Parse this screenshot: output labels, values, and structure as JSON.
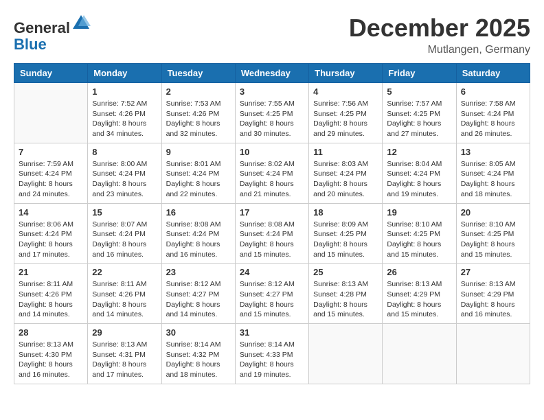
{
  "header": {
    "logo_general": "General",
    "logo_blue": "Blue",
    "month": "December 2025",
    "location": "Mutlangen, Germany"
  },
  "columns": [
    "Sunday",
    "Monday",
    "Tuesday",
    "Wednesday",
    "Thursday",
    "Friday",
    "Saturday"
  ],
  "weeks": [
    [
      {
        "day": "",
        "sunrise": "",
        "sunset": "",
        "daylight": ""
      },
      {
        "day": "1",
        "sunrise": "Sunrise: 7:52 AM",
        "sunset": "Sunset: 4:26 PM",
        "daylight": "Daylight: 8 hours and 34 minutes."
      },
      {
        "day": "2",
        "sunrise": "Sunrise: 7:53 AM",
        "sunset": "Sunset: 4:26 PM",
        "daylight": "Daylight: 8 hours and 32 minutes."
      },
      {
        "day": "3",
        "sunrise": "Sunrise: 7:55 AM",
        "sunset": "Sunset: 4:25 PM",
        "daylight": "Daylight: 8 hours and 30 minutes."
      },
      {
        "day": "4",
        "sunrise": "Sunrise: 7:56 AM",
        "sunset": "Sunset: 4:25 PM",
        "daylight": "Daylight: 8 hours and 29 minutes."
      },
      {
        "day": "5",
        "sunrise": "Sunrise: 7:57 AM",
        "sunset": "Sunset: 4:25 PM",
        "daylight": "Daylight: 8 hours and 27 minutes."
      },
      {
        "day": "6",
        "sunrise": "Sunrise: 7:58 AM",
        "sunset": "Sunset: 4:24 PM",
        "daylight": "Daylight: 8 hours and 26 minutes."
      }
    ],
    [
      {
        "day": "7",
        "sunrise": "Sunrise: 7:59 AM",
        "sunset": "Sunset: 4:24 PM",
        "daylight": "Daylight: 8 hours and 24 minutes."
      },
      {
        "day": "8",
        "sunrise": "Sunrise: 8:00 AM",
        "sunset": "Sunset: 4:24 PM",
        "daylight": "Daylight: 8 hours and 23 minutes."
      },
      {
        "day": "9",
        "sunrise": "Sunrise: 8:01 AM",
        "sunset": "Sunset: 4:24 PM",
        "daylight": "Daylight: 8 hours and 22 minutes."
      },
      {
        "day": "10",
        "sunrise": "Sunrise: 8:02 AM",
        "sunset": "Sunset: 4:24 PM",
        "daylight": "Daylight: 8 hours and 21 minutes."
      },
      {
        "day": "11",
        "sunrise": "Sunrise: 8:03 AM",
        "sunset": "Sunset: 4:24 PM",
        "daylight": "Daylight: 8 hours and 20 minutes."
      },
      {
        "day": "12",
        "sunrise": "Sunrise: 8:04 AM",
        "sunset": "Sunset: 4:24 PM",
        "daylight": "Daylight: 8 hours and 19 minutes."
      },
      {
        "day": "13",
        "sunrise": "Sunrise: 8:05 AM",
        "sunset": "Sunset: 4:24 PM",
        "daylight": "Daylight: 8 hours and 18 minutes."
      }
    ],
    [
      {
        "day": "14",
        "sunrise": "Sunrise: 8:06 AM",
        "sunset": "Sunset: 4:24 PM",
        "daylight": "Daylight: 8 hours and 17 minutes."
      },
      {
        "day": "15",
        "sunrise": "Sunrise: 8:07 AM",
        "sunset": "Sunset: 4:24 PM",
        "daylight": "Daylight: 8 hours and 16 minutes."
      },
      {
        "day": "16",
        "sunrise": "Sunrise: 8:08 AM",
        "sunset": "Sunset: 4:24 PM",
        "daylight": "Daylight: 8 hours and 16 minutes."
      },
      {
        "day": "17",
        "sunrise": "Sunrise: 8:08 AM",
        "sunset": "Sunset: 4:24 PM",
        "daylight": "Daylight: 8 hours and 15 minutes."
      },
      {
        "day": "18",
        "sunrise": "Sunrise: 8:09 AM",
        "sunset": "Sunset: 4:25 PM",
        "daylight": "Daylight: 8 hours and 15 minutes."
      },
      {
        "day": "19",
        "sunrise": "Sunrise: 8:10 AM",
        "sunset": "Sunset: 4:25 PM",
        "daylight": "Daylight: 8 hours and 15 minutes."
      },
      {
        "day": "20",
        "sunrise": "Sunrise: 8:10 AM",
        "sunset": "Sunset: 4:25 PM",
        "daylight": "Daylight: 8 hours and 15 minutes."
      }
    ],
    [
      {
        "day": "21",
        "sunrise": "Sunrise: 8:11 AM",
        "sunset": "Sunset: 4:26 PM",
        "daylight": "Daylight: 8 hours and 14 minutes."
      },
      {
        "day": "22",
        "sunrise": "Sunrise: 8:11 AM",
        "sunset": "Sunset: 4:26 PM",
        "daylight": "Daylight: 8 hours and 14 minutes."
      },
      {
        "day": "23",
        "sunrise": "Sunrise: 8:12 AM",
        "sunset": "Sunset: 4:27 PM",
        "daylight": "Daylight: 8 hours and 14 minutes."
      },
      {
        "day": "24",
        "sunrise": "Sunrise: 8:12 AM",
        "sunset": "Sunset: 4:27 PM",
        "daylight": "Daylight: 8 hours and 15 minutes."
      },
      {
        "day": "25",
        "sunrise": "Sunrise: 8:13 AM",
        "sunset": "Sunset: 4:28 PM",
        "daylight": "Daylight: 8 hours and 15 minutes."
      },
      {
        "day": "26",
        "sunrise": "Sunrise: 8:13 AM",
        "sunset": "Sunset: 4:29 PM",
        "daylight": "Daylight: 8 hours and 15 minutes."
      },
      {
        "day": "27",
        "sunrise": "Sunrise: 8:13 AM",
        "sunset": "Sunset: 4:29 PM",
        "daylight": "Daylight: 8 hours and 16 minutes."
      }
    ],
    [
      {
        "day": "28",
        "sunrise": "Sunrise: 8:13 AM",
        "sunset": "Sunset: 4:30 PM",
        "daylight": "Daylight: 8 hours and 16 minutes."
      },
      {
        "day": "29",
        "sunrise": "Sunrise: 8:13 AM",
        "sunset": "Sunset: 4:31 PM",
        "daylight": "Daylight: 8 hours and 17 minutes."
      },
      {
        "day": "30",
        "sunrise": "Sunrise: 8:14 AM",
        "sunset": "Sunset: 4:32 PM",
        "daylight": "Daylight: 8 hours and 18 minutes."
      },
      {
        "day": "31",
        "sunrise": "Sunrise: 8:14 AM",
        "sunset": "Sunset: 4:33 PM",
        "daylight": "Daylight: 8 hours and 19 minutes."
      },
      {
        "day": "",
        "sunrise": "",
        "sunset": "",
        "daylight": ""
      },
      {
        "day": "",
        "sunrise": "",
        "sunset": "",
        "daylight": ""
      },
      {
        "day": "",
        "sunrise": "",
        "sunset": "",
        "daylight": ""
      }
    ]
  ]
}
